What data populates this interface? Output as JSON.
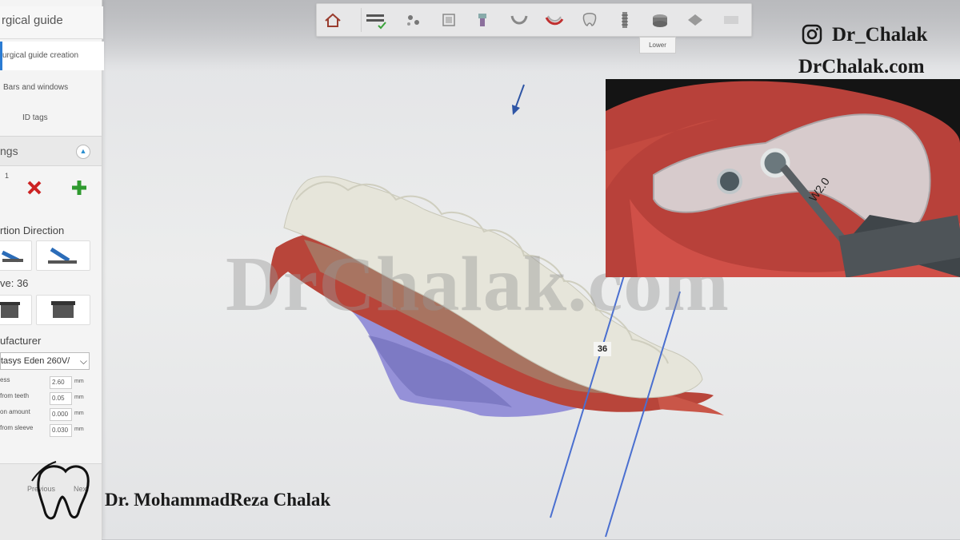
{
  "panel": {
    "title": "rgical guide",
    "steps": [
      "urgical guide creation",
      "Bars and windows",
      "ID tags"
    ],
    "section_title": "ngs",
    "counter": "1",
    "insertion_direction_label": "rtion Direction",
    "sleeve_label": "ve: 36",
    "manufacturer_label": "ufacturer",
    "manufacturer_value": "tasys Eden 260V/",
    "params": [
      {
        "label": "ess",
        "value": "2.60",
        "unit": "mm"
      },
      {
        "label": "from teeth",
        "value": "0.05",
        "unit": "mm"
      },
      {
        "label": "on amount",
        "value": "0.000",
        "unit": "mm"
      },
      {
        "label": "from sleeve",
        "value": "0.030",
        "unit": "mm"
      }
    ],
    "footer": {
      "previous": "Previous",
      "next": "Next"
    }
  },
  "toolbar": {
    "icons": [
      "home-icon",
      "checklist-icon",
      "implant-planning-icon",
      "crown-icon",
      "abutment-icon",
      "lower-arch-icon",
      "gum-icon",
      "tooth-icon",
      "implant-screw-icon",
      "guide-lower-icon",
      "bars-icon",
      "disabled-icon"
    ],
    "tooltip": "Lower"
  },
  "viewport": {
    "tooth_label": "36",
    "watermark": "DrChalak.com"
  },
  "inset": {
    "drill_label": "W2.0"
  },
  "branding": {
    "instagram_handle": "Dr_Chalak",
    "website": "DrChalak.com",
    "doctor_name": "Dr. MohammadReza Chalak"
  },
  "colors": {
    "accent": "#2b7cd3",
    "delete": "#cc2222",
    "add": "#2f9a2f",
    "gum": "#b8453a",
    "tooth": "#e7e6dc",
    "lower_scan": "#8b86d8"
  }
}
